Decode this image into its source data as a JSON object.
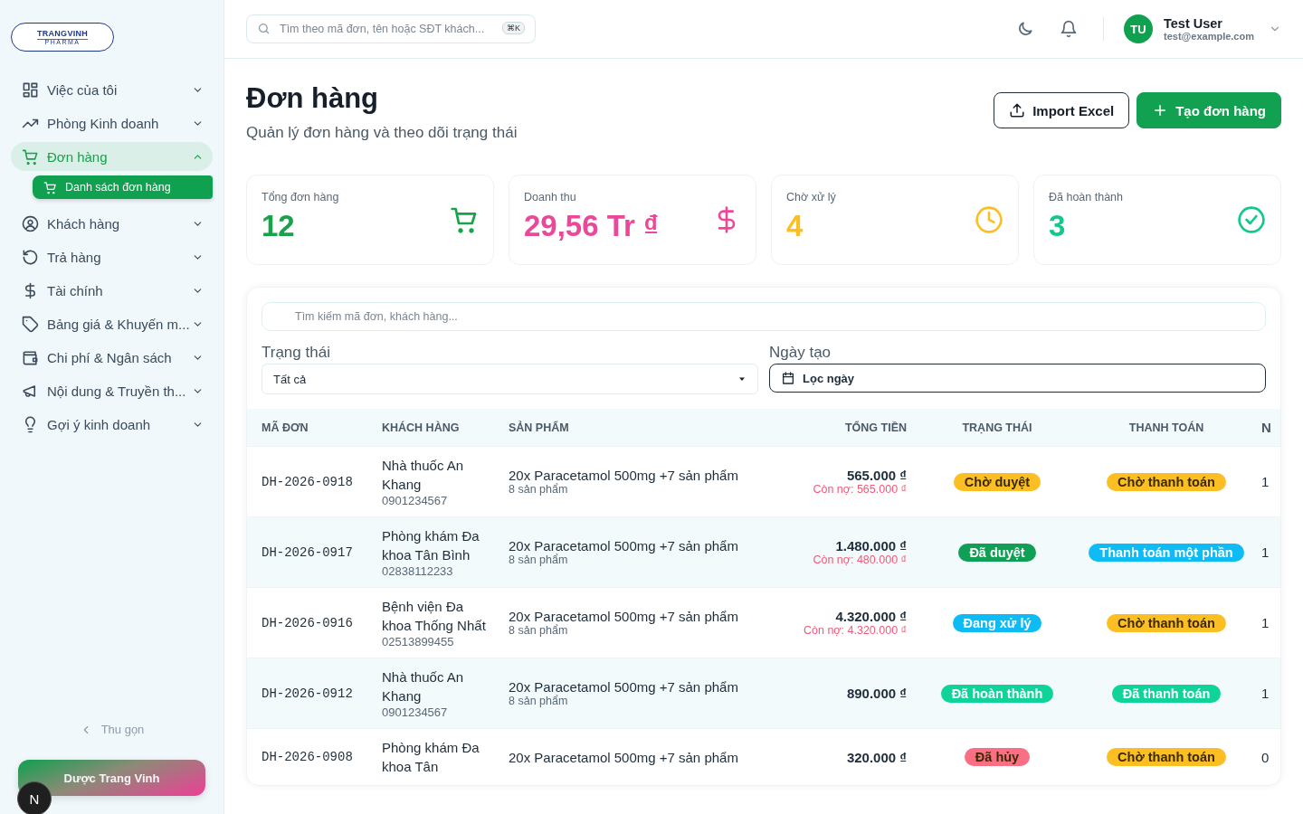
{
  "sidebar": {
    "logo": {
      "name": "TRANGVINH",
      "sub": "PHARMA"
    },
    "items": [
      {
        "label": "Việc của tôi",
        "expanded": false,
        "selected": false
      },
      {
        "label": "Phòng Kinh doanh",
        "expanded": false,
        "selected": false
      },
      {
        "label": "Đơn hàng",
        "expanded": true,
        "selected": true,
        "children": [
          {
            "label": "Danh sách đơn hàng",
            "selected": true
          }
        ]
      },
      {
        "label": "Khách hàng",
        "expanded": false,
        "selected": false
      },
      {
        "label": "Trả hàng",
        "expanded": false,
        "selected": false
      },
      {
        "label": "Tài chính",
        "expanded": false,
        "selected": false
      },
      {
        "label": "Bảng giá & Khuyến m...",
        "expanded": false,
        "selected": false
      },
      {
        "label": "Chi phí & Ngân sách",
        "expanded": false,
        "selected": false
      },
      {
        "label": "Nội dung & Truyền th...",
        "expanded": false,
        "selected": false
      },
      {
        "label": "Gợi ý kinh doanh",
        "expanded": false,
        "selected": false
      }
    ],
    "collapse": "Thu gọn",
    "company": "Dược Trang Vinh",
    "badge": "N"
  },
  "header": {
    "search": {
      "placeholder": "Tìm theo mã đơn, tên hoặc SĐT khách...",
      "shortcut": "⌘K"
    },
    "user": {
      "initials": "TU",
      "name": "Test User",
      "email": "test@example.com"
    }
  },
  "page": {
    "title": "Đơn hàng",
    "subtitle": "Quản lý đơn hàng và theo dõi trạng thái",
    "buttons": [
      {
        "kind": "secondary",
        "label": "Import Excel"
      },
      {
        "kind": "primary",
        "label": "Tạo đơn hàng"
      }
    ]
  },
  "stats": [
    {
      "label": "Tổng đơn hàng",
      "value": "12",
      "color": "#16a34a"
    },
    {
      "label": "Doanh thu",
      "value": "29,56 Tr ₫",
      "color": "#ec4899"
    },
    {
      "label": "Chờ xử lý",
      "value": "4",
      "color": "#fbbf24"
    },
    {
      "label": "Đã hoàn thành",
      "value": "3",
      "color": "#10c98a"
    }
  ],
  "filters": {
    "search": {
      "placeholder": "Tìm kiếm mã đơn, khách hàng..."
    },
    "status": {
      "label": "Trạng thái",
      "value": "Tất cả"
    },
    "date": {
      "label": "Ngày tạo",
      "value": "Lọc ngày"
    }
  },
  "table": {
    "columns": [
      "MÃ ĐƠN",
      "KHÁCH HÀNG",
      "SẢN PHẨM",
      "TỔNG TIỀN",
      "TRẠNG THÁI",
      "THANH TOÁN",
      "N"
    ],
    "rows": [
      {
        "id": "DH-2026-0918",
        "customer": "Nhà thuốc An Khang",
        "phone": "0901234567",
        "product": "20x Paracetamol 500mg +7 sản phẩm",
        "count": "8 sản phẩm",
        "total": "565.000 ₫",
        "debt": "Còn nợ: 565.000 ₫",
        "status": {
          "label": "Chờ duyệt",
          "color": "#fbbf24"
        },
        "payment": {
          "label": "Chờ thanh toán",
          "color": "#fbbf24"
        },
        "column_7": "1"
      },
      {
        "id": "DH-2026-0917",
        "customer": "Phòng khám Đa khoa Tân Bình",
        "phone": "02838112233",
        "product": "20x Paracetamol 500mg +7 sản phẩm",
        "count": "8 sản phẩm",
        "total": "1.480.000 ₫",
        "debt": "Còn nợ: 480.000 ₫",
        "status": {
          "label": "Đã duyệt",
          "color": "#0f9f55"
        },
        "payment": {
          "label": "Thanh toán một phần",
          "color": "#0ebbf5"
        },
        "column_7": "1"
      },
      {
        "id": "DH-2026-0916",
        "customer": "Bệnh viện Đa khoa Thống Nhất",
        "phone": "02513899455",
        "product": "20x Paracetamol 500mg +7 sản phẩm",
        "count": "8 sản phẩm",
        "total": "4.320.000 ₫",
        "debt": "Còn nợ: 4.320.000 ₫",
        "status": {
          "label": "Đang xử lý",
          "color": "#0ebbf5"
        },
        "payment": {
          "label": "Chờ thanh toán",
          "color": "#fbbf24"
        },
        "column_7": "1"
      },
      {
        "id": "DH-2026-0912",
        "customer": "Nhà thuốc An Khang",
        "phone": "0901234567",
        "product": "20x Paracetamol 500mg +7 sản phẩm",
        "count": "8 sản phẩm",
        "total": "890.000 ₫",
        "status": {
          "label": "Đã hoàn thành",
          "color": "#10d39a"
        },
        "payment": {
          "label": "Đã thanh toán",
          "color": "#10d39a"
        },
        "column_7": "1"
      },
      {
        "id": "DH-2026-0908",
        "customer": "Phòng khám Đa khoa Tân",
        "product": "20x Paracetamol 500mg +7 sản phẩm",
        "total": "320.000 ₫",
        "status": {
          "label": "Đã hủy",
          "color": "#fb6f84"
        },
        "payment": {
          "label": "Chờ thanh toán",
          "color": "#fbbf24"
        },
        "column_7": "0"
      }
    ]
  }
}
